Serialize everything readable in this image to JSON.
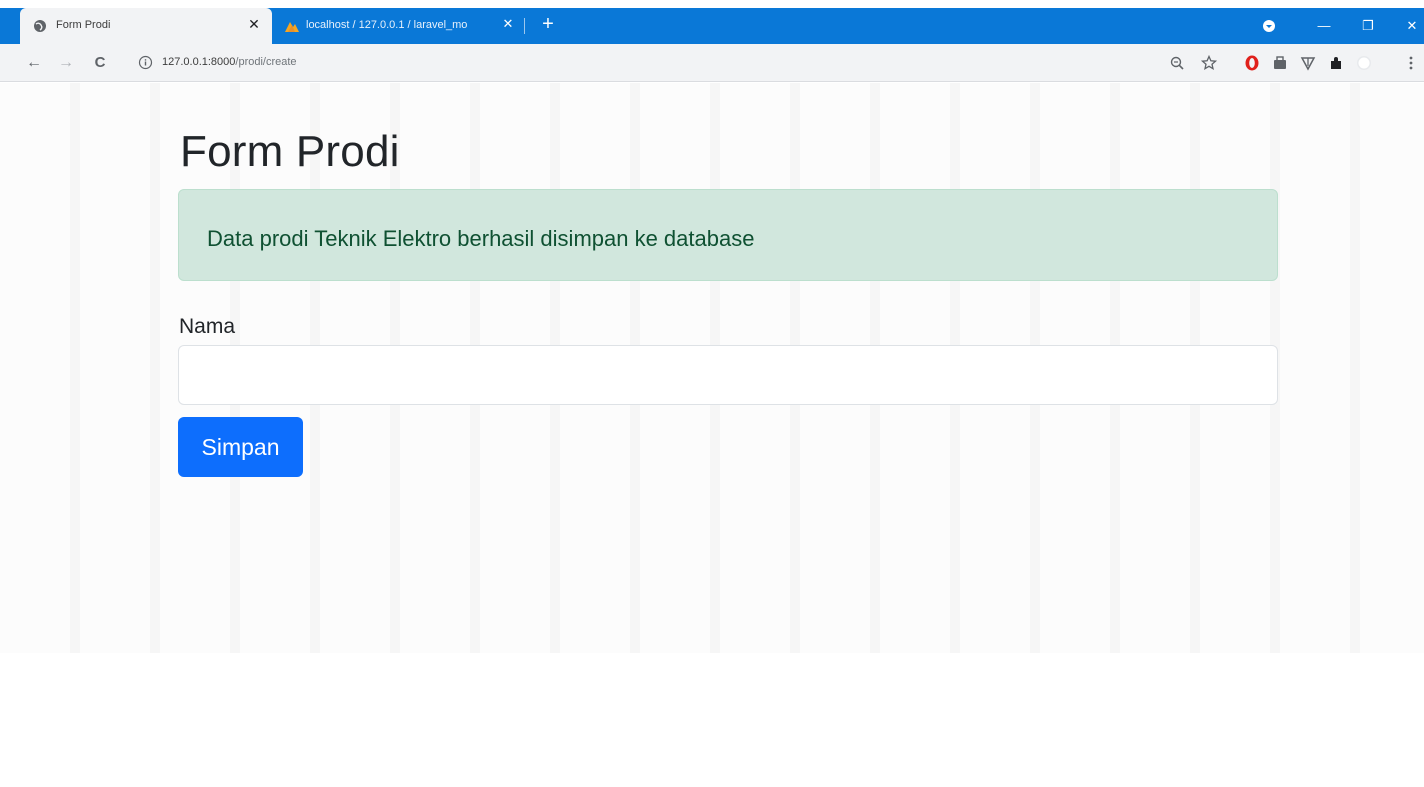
{
  "browser": {
    "tabs": [
      {
        "title": "Form Prodi",
        "active": true
      },
      {
        "title": "localhost / 127.0.0.1 / laravel_mo",
        "active": false
      }
    ],
    "close_glyph": "✕",
    "new_tab_glyph": "+",
    "window_controls": {
      "minimize": "—",
      "restore": "❐",
      "close": "✕"
    },
    "nav": {
      "back": "←",
      "forward": "→",
      "reload": "C"
    },
    "address": {
      "host": "127.0.0.1:8000",
      "path": "/prodi/create"
    },
    "icons": [
      "zoom-icon",
      "star-icon",
      "opera-icon",
      "extension-icon",
      "vpn-icon",
      "puzzle-icon",
      "profile-icon",
      "menu-icon"
    ]
  },
  "page": {
    "title": "Form Prodi",
    "alert": {
      "message": "Data prodi Teknik Elektro berhasil disimpan ke database",
      "color": "#d1e7dd"
    },
    "form": {
      "nama_label": "Nama",
      "nama_value": "",
      "submit_label": "Simpan",
      "submit_color": "#0d6efd"
    }
  },
  "colors": {
    "tabbar": "#0a78d7",
    "toolbar": "#f2f3f5"
  }
}
